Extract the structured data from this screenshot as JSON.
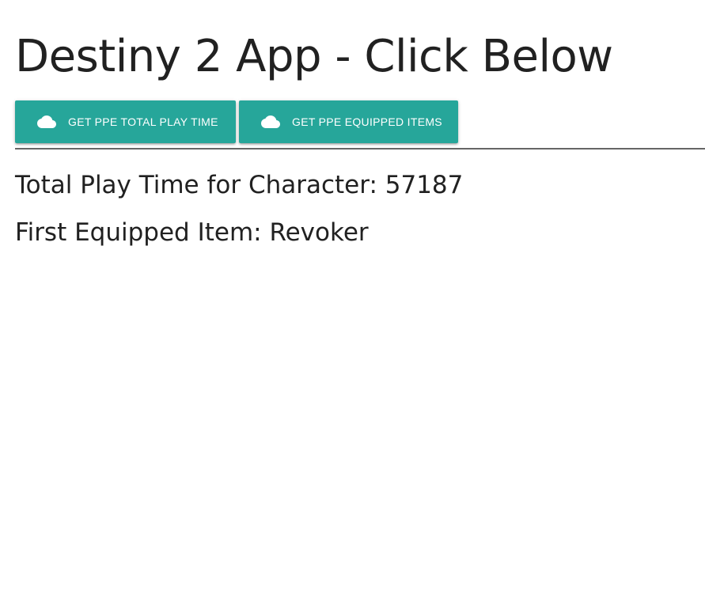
{
  "page": {
    "title": "Destiny 2 App - Click Below"
  },
  "buttons": [
    {
      "label": "GET PPE TOTAL PLAY TIME",
      "icon": "cloud-icon"
    },
    {
      "label": "GET PPE EQUIPPED ITEMS",
      "icon": "cloud-icon"
    }
  ],
  "results": {
    "playtime_text": "Total Play Time for Character: 57187",
    "equipped_text": "First Equipped Item: Revoker"
  },
  "colors": {
    "button_background": "#26a69a",
    "button_text": "#ffffff",
    "text": "#212121",
    "divider": "#666666"
  }
}
